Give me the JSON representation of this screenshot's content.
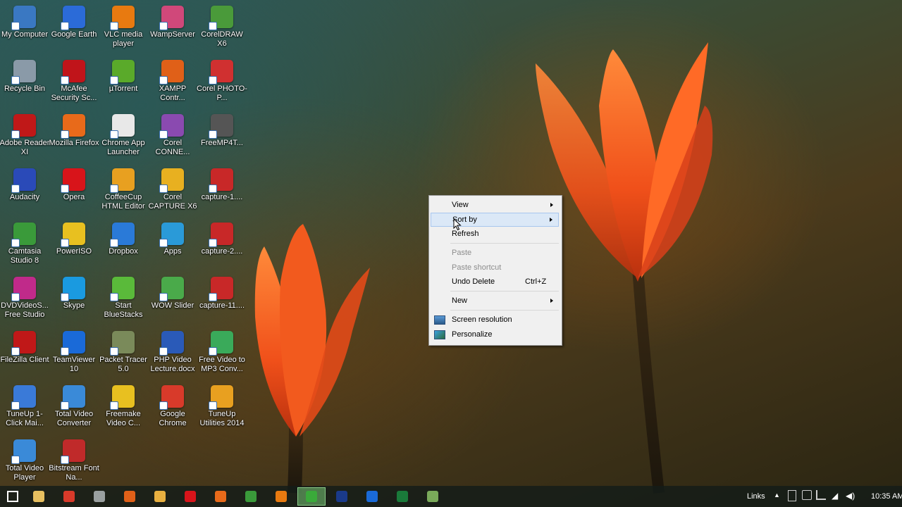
{
  "desktop_icons": [
    {
      "label": "My Computer",
      "icon": "computer-icon",
      "color": "#3a78c2"
    },
    {
      "label": "Google Earth",
      "icon": "globe-icon",
      "color": "#2b6bd8"
    },
    {
      "label": "VLC media player",
      "icon": "vlc-cone-icon",
      "color": "#e87a10"
    },
    {
      "label": "WampServer",
      "icon": "wamp-icon",
      "color": "#d0487a"
    },
    {
      "label": "CorelDRAW X6",
      "icon": "coreldraw-icon",
      "color": "#4a9a3a"
    },
    {
      "label": "Recycle Bin",
      "icon": "recycle-bin-icon",
      "color": "#8a9aa8"
    },
    {
      "label": "McAfee Security Sc...",
      "icon": "mcafee-icon",
      "color": "#c0141a"
    },
    {
      "label": "µTorrent",
      "icon": "utorrent-icon",
      "color": "#5aaa2a"
    },
    {
      "label": "XAMPP Contr...",
      "icon": "xampp-icon",
      "color": "#e06018"
    },
    {
      "label": "Corel PHOTO-P...",
      "icon": "corel-photo-icon",
      "color": "#d03030"
    },
    {
      "label": "Adobe Reader XI",
      "icon": "adobe-reader-icon",
      "color": "#c01818"
    },
    {
      "label": "Mozilla Firefox",
      "icon": "firefox-icon",
      "color": "#e86a1a"
    },
    {
      "label": "Chrome App Launcher",
      "icon": "app-launcher-icon",
      "color": "#e8e8e8"
    },
    {
      "label": "Corel CONNE...",
      "icon": "corel-connect-icon",
      "color": "#8a4ab0"
    },
    {
      "label": "FreeMP4T...",
      "icon": "film-reel-icon",
      "color": "#555555"
    },
    {
      "label": "Audacity",
      "icon": "audacity-icon",
      "color": "#2a4ab8"
    },
    {
      "label": "Opera",
      "icon": "opera-icon",
      "color": "#d8141a"
    },
    {
      "label": "CoffeeCup HTML Editor",
      "icon": "coffeecup-icon",
      "color": "#e8a020"
    },
    {
      "label": "Corel CAPTURE X6",
      "icon": "corel-capture-icon",
      "color": "#e8b020"
    },
    {
      "label": "capture-1....",
      "icon": "video-file-icon",
      "color": "#c82828"
    },
    {
      "label": "Camtasia Studio 8",
      "icon": "camtasia-icon",
      "color": "#3a9a3a"
    },
    {
      "label": "PowerISO",
      "icon": "poweriso-icon",
      "color": "#e8c020"
    },
    {
      "label": "Dropbox",
      "icon": "dropbox-icon",
      "color": "#2a7ad8"
    },
    {
      "label": "Apps",
      "icon": "apps-icon",
      "color": "#2a9ad8"
    },
    {
      "label": "capture-2....",
      "icon": "video-file-icon",
      "color": "#c82828"
    },
    {
      "label": "DVDVideoS... Free Studio",
      "icon": "dvdvideosoft-icon",
      "color": "#c02a8a"
    },
    {
      "label": "Skype",
      "icon": "skype-icon",
      "color": "#1a9ae0"
    },
    {
      "label": "Start BlueStacks",
      "icon": "bluestacks-icon",
      "color": "#5aba3a"
    },
    {
      "label": "WOW Slider",
      "icon": "wow-slider-icon",
      "color": "#4aaa4a"
    },
    {
      "label": "capture-11....",
      "icon": "video-file-icon",
      "color": "#c82828"
    },
    {
      "label": "FileZilla Client",
      "icon": "filezilla-icon",
      "color": "#c01818"
    },
    {
      "label": "TeamViewer 10",
      "icon": "teamviewer-icon",
      "color": "#1a6ad8"
    },
    {
      "label": "Packet Tracer 5.0",
      "icon": "packet-tracer-icon",
      "color": "#7a8a5a"
    },
    {
      "label": "PHP Video Lecture.docx",
      "icon": "word-doc-icon",
      "color": "#2a5ab8"
    },
    {
      "label": "Free Video to MP3 Conv...",
      "icon": "video-to-mp3-icon",
      "color": "#3aaa5a"
    },
    {
      "label": "TuneUp 1-Click Mai...",
      "icon": "tuneup-icon",
      "color": "#3a7ad8"
    },
    {
      "label": "Total Video Converter",
      "icon": "total-video-converter-icon",
      "color": "#3a8ad8"
    },
    {
      "label": "Freemake Video C...",
      "icon": "freemake-icon",
      "color": "#e8c020"
    },
    {
      "label": "Google Chrome",
      "icon": "chrome-icon",
      "color": "#d83a2a"
    },
    {
      "label": "TuneUp Utilities 2014",
      "icon": "tuneup-utilities-icon",
      "color": "#e8a020"
    },
    {
      "label": "Total Video Player",
      "icon": "total-video-player-icon",
      "color": "#3a8ad8"
    },
    {
      "label": "Bitstream Font Na...",
      "icon": "bitstream-icon",
      "color": "#c02a2a"
    }
  ],
  "context_menu": {
    "items": [
      {
        "label": "View",
        "submenu": true
      },
      {
        "label": "Sort by",
        "submenu": true,
        "highlighted": true
      },
      {
        "label": "Refresh"
      },
      {
        "label": "Paste",
        "disabled": true
      },
      {
        "label": "Paste shortcut",
        "disabled": true
      },
      {
        "label": "Undo Delete",
        "shortcut": "Ctrl+Z"
      },
      {
        "label": "New",
        "submenu": true
      },
      {
        "label": "Screen resolution",
        "icon": "screen-resolution-icon"
      },
      {
        "label": "Personalize",
        "icon": "personalize-icon"
      }
    ]
  },
  "taskbar": {
    "buttons": [
      {
        "icon": "start-windows-icon",
        "color": "#ffffff"
      },
      {
        "icon": "file-explorer-icon",
        "color": "#e8c060",
        "active": false
      },
      {
        "icon": "chrome-icon",
        "color": "#d83a2a"
      },
      {
        "icon": "keyboard-icon",
        "color": "#9aa0a0"
      },
      {
        "icon": "xampp-icon",
        "color": "#e06018"
      },
      {
        "icon": "notepad-icon",
        "color": "#e8b040"
      },
      {
        "icon": "opera-icon",
        "color": "#d8141a"
      },
      {
        "icon": "firefox-icon",
        "color": "#e86a1a"
      },
      {
        "icon": "camtasia-icon",
        "color": "#3a9a3a"
      },
      {
        "icon": "vlc-cone-icon",
        "color": "#e87a10"
      },
      {
        "icon": "camtasia-recorder-icon",
        "color": "#3aaa3a",
        "active": true
      },
      {
        "icon": "photoshop-icon",
        "color": "#1a3a8a"
      },
      {
        "icon": "outlook-icon",
        "color": "#1a6ad8"
      },
      {
        "icon": "excel-icon",
        "color": "#1a7a3a"
      },
      {
        "icon": "camtasia-icon",
        "color": "#7aaa5a"
      }
    ],
    "tray": {
      "links_label": "Links",
      "clock": "10:35 AM"
    }
  }
}
